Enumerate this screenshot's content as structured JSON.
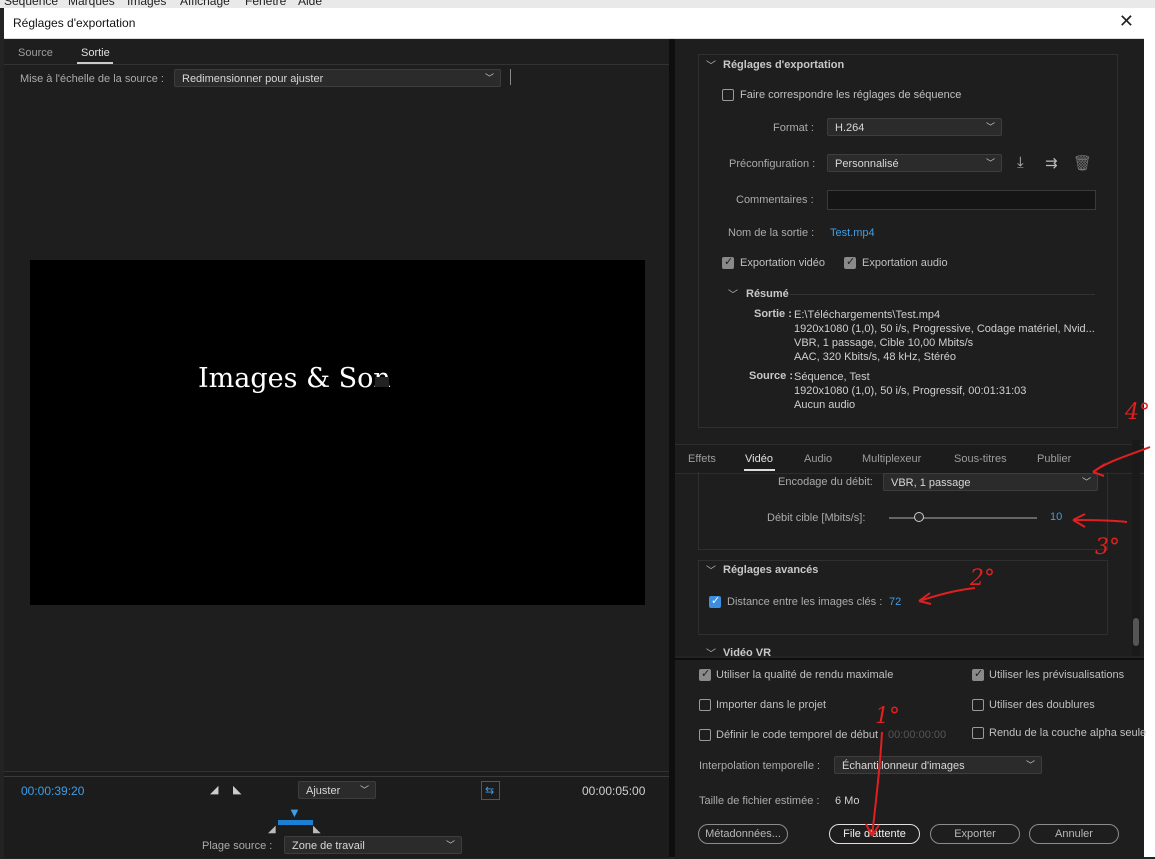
{
  "menubar": [
    "Séquence",
    "Marques",
    "Images",
    "Affichage",
    "Fenêtre",
    "Aide"
  ],
  "window": {
    "title": "Réglages d'exportation",
    "close": "✕"
  },
  "preview": {
    "tabs": [
      "Source",
      "Sortie"
    ],
    "active_tab": "Sortie",
    "scale_label": "Mise à l'échelle de la source :",
    "scale_value": "Redimensionner pour ajuster",
    "frame_text": "Images & Son",
    "timecode_left": "00:00:39:20",
    "timecode_right": "00:00:05:00",
    "fit_value": "Ajuster",
    "range_label": "Plage source :",
    "range_value": "Zone de travail"
  },
  "export": {
    "section_title": "Réglages d'exportation",
    "match_seq": "Faire correspondre les réglages de séquence",
    "format_label": "Format :",
    "format_value": "H.264",
    "preset_label": "Préconfiguration :",
    "preset_value": "Personnalisé",
    "comments_label": "Commentaires :",
    "comments_value": "",
    "output_label": "Nom de la sortie :",
    "output_value": "Test.mp4",
    "export_video": "Exportation vidéo",
    "export_audio": "Exportation audio",
    "summary_title": "Résumé",
    "out_label": "Sortie :",
    "out_lines": [
      "E:\\Téléchargements\\Test.mp4",
      "1920x1080 (1,0), 50 i/s, Progressive, Codage matériel, Nvid...",
      "VBR, 1 passage, Cible 10,00  Mbits/s",
      "AAC, 320  Kbits/s, 48  kHz, Stéréo"
    ],
    "src_label": "Source :",
    "src_lines": [
      "Séquence, Test",
      "1920x1080 (1,0), 50  i/s, Progressif, 00:01:31:03",
      "Aucun audio"
    ]
  },
  "tabs2": [
    "Effets",
    "Vidéo",
    "Audio",
    "Multiplexeur",
    "Sous-titres",
    "Publier"
  ],
  "tabs2_active": "Vidéo",
  "video": {
    "bitrate_label": "Encodage du débit:",
    "bitrate_value": "VBR, 1 passage",
    "target_label": "Débit cible [Mbits/s]:",
    "target_value": "10",
    "target_fraction": 0.2,
    "advanced_title": "Réglages avancés",
    "keyframe_label": "Distance entre les images clés :",
    "keyframe_value": "72",
    "vr_title": "Vidéo VR"
  },
  "bottom": {
    "max_quality": "Utiliser la qualité de rendu maximale",
    "previews": "Utiliser les prévisualisations",
    "import": "Importer dans le projet",
    "proxies": "Utiliser des doublures",
    "set_tc": "Définir le code temporel de début",
    "tc_value": "00:00:00:00",
    "alpha": "Rendu de la couche alpha seule",
    "interp_label": "Interpolation temporelle :",
    "interp_value": "Échantillonneur d'images",
    "size_label": "Taille de fichier estimée :",
    "size_value": "6 Mo",
    "btn_meta": "Métadonnées...",
    "btn_queue": "File d'attente",
    "btn_export": "Exporter",
    "btn_cancel": "Annuler"
  },
  "annotations": [
    "4°",
    "3°",
    "2°",
    "1°"
  ]
}
